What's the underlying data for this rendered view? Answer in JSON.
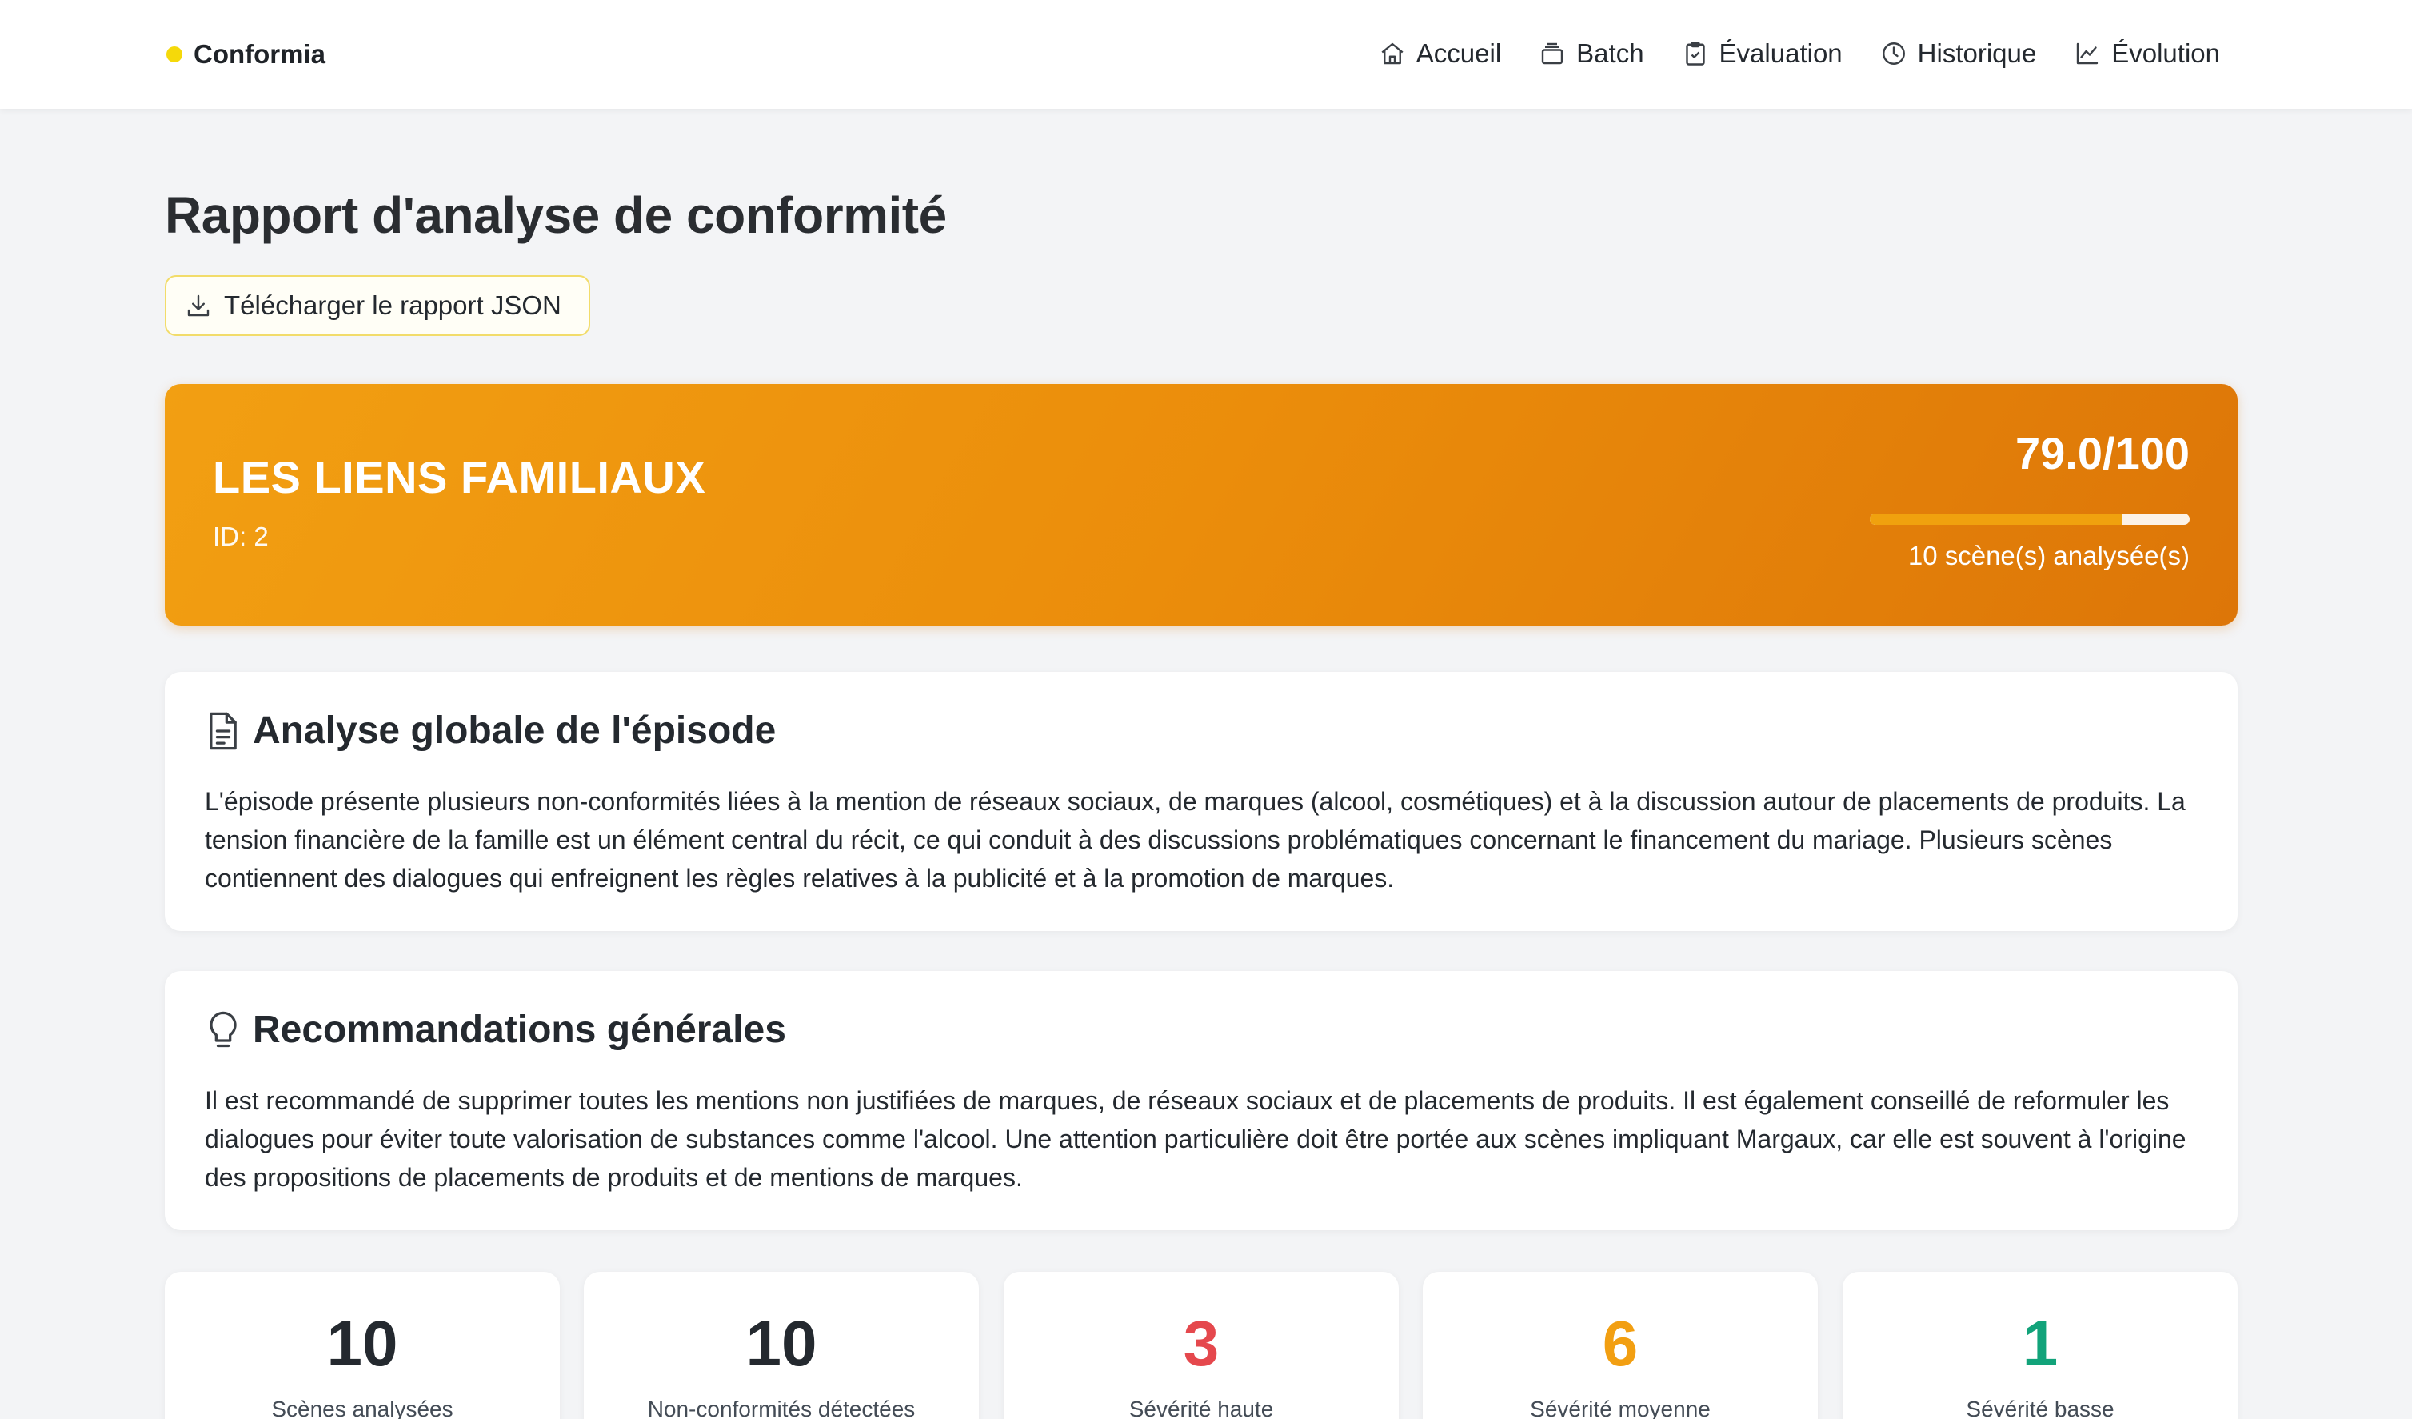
{
  "brand": {
    "name": "Conformia",
    "dot_color": "#f5d90a"
  },
  "nav": [
    {
      "label": "Accueil",
      "icon": "home-icon"
    },
    {
      "label": "Batch",
      "icon": "layers-icon"
    },
    {
      "label": "Évaluation",
      "icon": "clipboard-check-icon"
    },
    {
      "label": "Historique",
      "icon": "clock-icon"
    },
    {
      "label": "Évolution",
      "icon": "chart-line-icon"
    }
  ],
  "page": {
    "title": "Rapport d'analyse de conformité",
    "download_label": "Télécharger le rapport JSON"
  },
  "episode": {
    "title": "LES LIENS FAMILIAUX",
    "id_label": "ID: 2",
    "score_label": "79.0/100",
    "score_fraction": 0.79,
    "scenes_label": "10 scène(s) analysée(s)",
    "accent_color": "#f29f12"
  },
  "analysis": {
    "title": "Analyse globale de l'épisode",
    "icon": "document-icon",
    "text": "L'épisode présente plusieurs non-conformités liées à la mention de réseaux sociaux, de marques (alcool, cosmétiques) et à la discussion autour de placements de produits. La tension financière de la famille est un élément central du récit, ce qui conduit à des discussions problématiques concernant le financement du mariage. Plusieurs scènes contiennent des dialogues qui enfreignent les règles relatives à la publicité et à la promotion de marques."
  },
  "recommendations": {
    "title": "Recommandations générales",
    "icon": "lightbulb-icon",
    "text": "Il est recommandé de supprimer toutes les mentions non justifiées de marques, de réseaux sociaux et de placements de produits. Il est également conseillé de reformuler les dialogues pour éviter toute valorisation de substances comme l'alcool. Une attention particulière doit être portée aux scènes impliquant Margaux, car elle est souvent à l'origine des propositions de placements de produits et de mentions de marques."
  },
  "stats": [
    {
      "value": "10",
      "label": "Scènes analysées",
      "color": "#24292f"
    },
    {
      "value": "10",
      "label": "Non-conformités détectées",
      "color": "#24292f"
    },
    {
      "value": "3",
      "label": "Sévérité haute",
      "color": "#e5484d"
    },
    {
      "value": "6",
      "label": "Sévérité moyenne",
      "color": "#f29f12"
    },
    {
      "value": "1",
      "label": "Sévérité basse",
      "color": "#12a37a"
    }
  ]
}
